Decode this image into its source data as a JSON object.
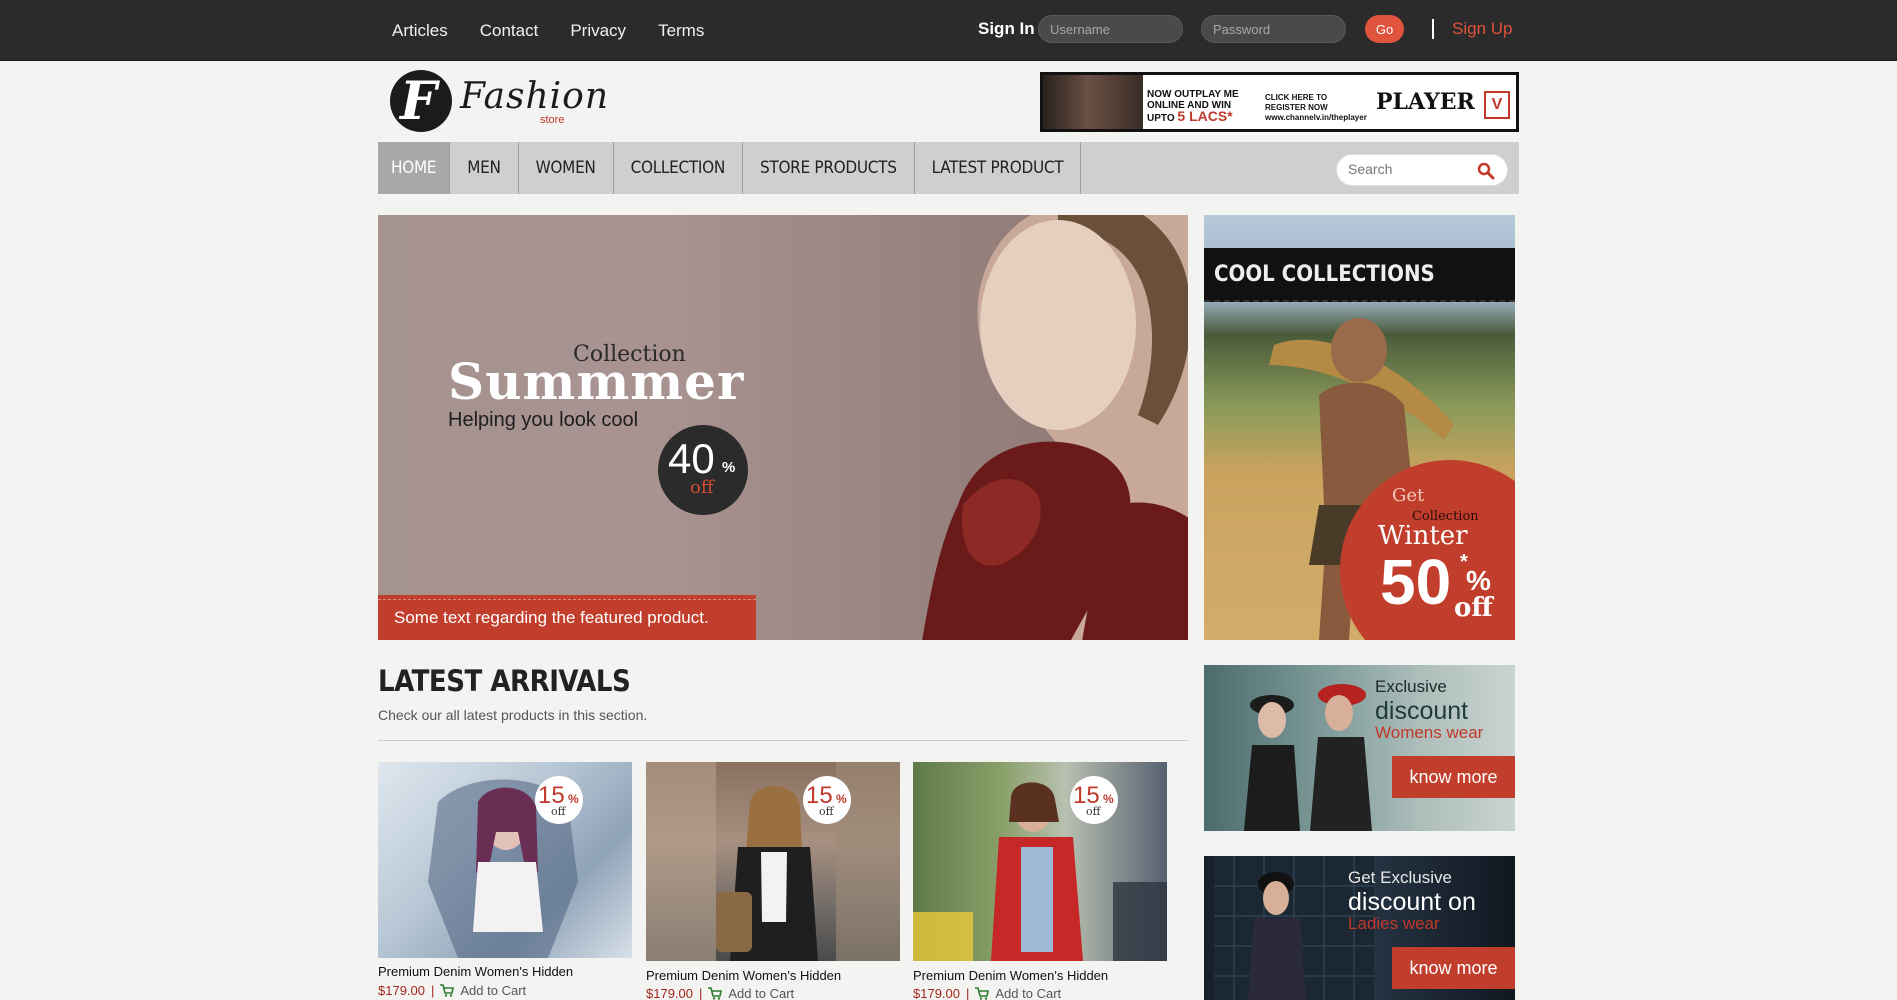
{
  "topbar": {
    "links": [
      "Articles",
      "Contact",
      "Privacy",
      "Terms"
    ],
    "signin_label": "Sign In",
    "username_placeholder": "Username",
    "password_placeholder": "Password",
    "go_label": "Go",
    "signup_label": "Sign Up"
  },
  "header": {
    "logo_text": "Fashion",
    "logo_sub": "store",
    "ad": {
      "line1": "NOW OUTPLAY ME ONLINE AND WIN UPTO",
      "line1_amount": "5 LACS*",
      "line2": "CLICK HERE TO REGISTER NOW www.channelv.in/theplayer",
      "brand": "PLAYER",
      "channel": "V"
    }
  },
  "nav": {
    "items": [
      "HOME",
      "MEN",
      "WOMEN",
      "COLLECTION",
      "STORE PRODUCTS",
      "LATEST PRODUCT"
    ],
    "search_placeholder": "Search"
  },
  "hero": {
    "collection": "Collection",
    "title": "Summmer",
    "tagline": "Helping you look cool",
    "discount_number": "40",
    "discount_pct": "%",
    "discount_off": "off",
    "caption": "Some text regarding the featured product."
  },
  "cool": {
    "header": "COOL COLLECTIONS",
    "get": "Get",
    "collection": "Collection",
    "season": "Winter",
    "number": "50",
    "star": "*",
    "pct": "%",
    "off": "off"
  },
  "latest": {
    "title": "LATEST ARRIVALS",
    "subtitle": "Check our all latest products in this section.",
    "products": [
      {
        "name": "Premium Denim Women's Hidden",
        "price": "$179.00",
        "cart": "Add to Cart",
        "badge_num": "15",
        "badge_pct": "%",
        "badge_off": "off"
      },
      {
        "name": "Premium Denim Women's Hidden",
        "price": "$179.00",
        "cart": "Add to Cart",
        "badge_num": "15",
        "badge_pct": "%",
        "badge_off": "off"
      },
      {
        "name": "Premium Denim Women's Hidden",
        "price": "$179.00",
        "cart": "Add to Cart",
        "badge_num": "15",
        "badge_pct": "%",
        "badge_off": "off"
      }
    ],
    "separator": "|"
  },
  "promos": [
    {
      "line1": "Exclusive",
      "line2": "discount",
      "line3": "Womens wear",
      "button": "know more"
    },
    {
      "line1": "Get Exclusive",
      "line2": "discount on",
      "line3": "Ladies wear",
      "button": "know more"
    }
  ],
  "colors": {
    "accent": "#c13d2c",
    "topbar": "#2b2b2b",
    "nav": "#cfcfcf"
  }
}
